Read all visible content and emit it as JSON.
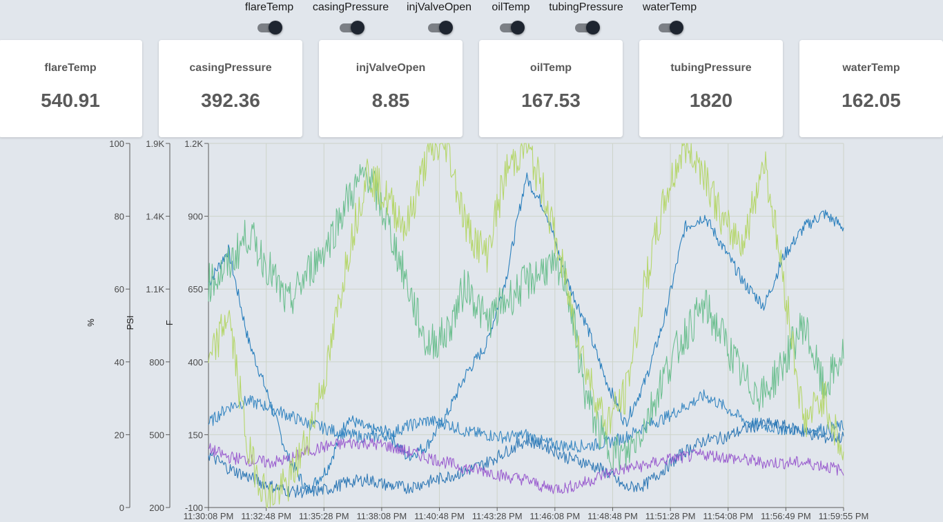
{
  "toggles": [
    {
      "label": "flareTemp",
      "on": true
    },
    {
      "label": "casingPressure",
      "on": true
    },
    {
      "label": "injValveOpen",
      "on": true
    },
    {
      "label": "oilTemp",
      "on": true
    },
    {
      "label": "tubingPressure",
      "on": true
    },
    {
      "label": "waterTemp",
      "on": true
    }
  ],
  "cards": [
    {
      "label": "flareTemp",
      "value": "540.91"
    },
    {
      "label": "casingPressure",
      "value": "392.36"
    },
    {
      "label": "injValveOpen",
      "value": "8.85"
    },
    {
      "label": "oilTemp",
      "value": "167.53"
    },
    {
      "label": "tubingPressure",
      "value": "1820"
    },
    {
      "label": "waterTemp",
      "value": "162.05"
    }
  ],
  "chart_data": {
    "type": "line",
    "title": "",
    "grid": true,
    "legend": "none",
    "x_ticks": [
      "11:30:08 PM",
      "11:32:48 PM",
      "11:35:28 PM",
      "11:38:08 PM",
      "11:40:48 PM",
      "11:43:28 PM",
      "11:46:08 PM",
      "11:48:48 PM",
      "11:51:28 PM",
      "11:54:08 PM",
      "11:56:49 PM",
      "11:59:55 PM"
    ],
    "x_range": [
      "11:30:08 PM",
      "11:59:55 PM"
    ],
    "axes": [
      {
        "id": "percent",
        "label": "%",
        "range": [
          0,
          100
        ],
        "ticks": [
          "0",
          "20",
          "40",
          "60",
          "80",
          "100"
        ]
      },
      {
        "id": "psi",
        "label": "PSI",
        "range": [
          200,
          1900
        ],
        "ticks": [
          "200",
          "500",
          "800",
          "1.1K",
          "1.4K",
          "1.9K"
        ]
      },
      {
        "id": "f",
        "label": "F",
        "range": [
          -100,
          1200
        ],
        "ticks": [
          "-100",
          "150",
          "400",
          "650",
          "900",
          "1.2K"
        ]
      }
    ],
    "series": [
      {
        "axis": "f",
        "color": "#2a7fbd",
        "values": [
          700,
          820,
          500,
          300,
          80,
          -40,
          40,
          220,
          180,
          170,
          80,
          120,
          230,
          380,
          480,
          720,
          1080,
          960,
          720,
          560,
          360,
          200,
          350,
          580,
          900,
          940,
          820,
          700,
          620,
          800,
          900,
          950,
          900
        ]
      },
      {
        "axis": "f",
        "color": "#3a88c2",
        "values": [
          200,
          260,
          280,
          260,
          230,
          200,
          180,
          160,
          150,
          160,
          190,
          210,
          200,
          170,
          160,
          150,
          160,
          130,
          120,
          120,
          130,
          150,
          190,
          220,
          260,
          300,
          260,
          210,
          190,
          180,
          175,
          180,
          190
        ]
      },
      {
        "axis": "f",
        "color": "#2f78b5",
        "values": [
          90,
          40,
          10,
          -20,
          -40,
          -45,
          -35,
          -10,
          0,
          -20,
          -30,
          -10,
          10,
          30,
          60,
          100,
          140,
          120,
          80,
          60,
          30,
          -30,
          -20,
          40,
          100,
          140,
          150,
          180,
          200,
          190,
          170,
          150,
          150
        ]
      },
      {
        "axis": "f",
        "color": "#9b5fcf",
        "values": [
          110,
          80,
          70,
          60,
          70,
          100,
          120,
          130,
          130,
          120,
          100,
          80,
          60,
          40,
          30,
          10,
          0,
          -30,
          -30,
          -10,
          20,
          40,
          50,
          70,
          80,
          90,
          80,
          70,
          60,
          60,
          60,
          50,
          30
        ]
      },
      {
        "axis": "f",
        "color": "#6dbf90",
        "values": [
          700,
          760,
          880,
          760,
          620,
          740,
          840,
          1000,
          1100,
          920,
          700,
          480,
          520,
          700,
          560,
          640,
          700,
          760,
          720,
          300,
          120,
          80,
          200,
          380,
          520,
          620,
          500,
          350,
          300,
          420,
          560,
          320,
          450
        ]
      },
      {
        "axis": "f",
        "color": "#b5d66a",
        "values": [
          400,
          600,
          100,
          -70,
          -20,
          150,
          400,
          800,
          1100,
          1000,
          900,
          1150,
          1200,
          900,
          800,
          1100,
          1200,
          1000,
          700,
          400,
          200,
          300,
          700,
          1000,
          1200,
          1100,
          900,
          850,
          1150,
          700,
          200,
          300,
          80
        ]
      }
    ]
  }
}
